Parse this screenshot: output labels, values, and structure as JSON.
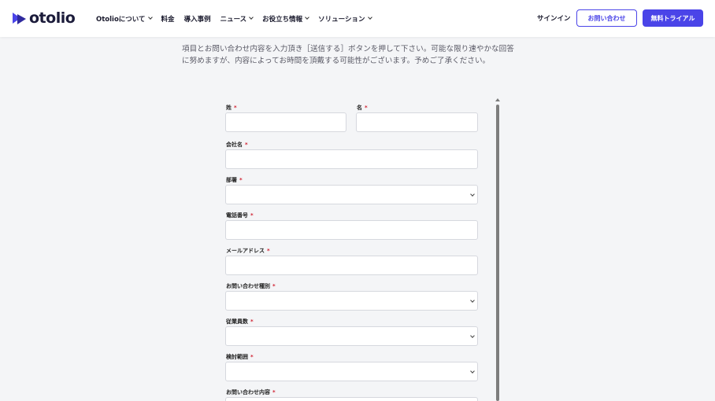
{
  "header": {
    "logo_text": "otolio",
    "nav": [
      {
        "label": "Otolioについて",
        "has_dropdown": true
      },
      {
        "label": "料金",
        "has_dropdown": false
      },
      {
        "label": "導入事例",
        "has_dropdown": false
      },
      {
        "label": "ニュース",
        "has_dropdown": true
      },
      {
        "label": "お役立ち情報",
        "has_dropdown": true
      },
      {
        "label": "ソリューション",
        "has_dropdown": true
      }
    ],
    "signin": "サインイン",
    "contact_button": "お問い合わせ",
    "trial_button": "無料トライアル",
    "accent_color": "#4a44e8"
  },
  "intro": {
    "line1": "項目とお問い合わせ内容を入力頂き［送信する］ボタンを押して下さい。可能な限り速やかな回答",
    "line2": "に努めますが、内容によってお時間を頂戴する可能性がございます。予めご了承ください。"
  },
  "form": {
    "required_mark": "*",
    "last_name": "姓",
    "first_name": "名",
    "company": "会社名",
    "department": "部署",
    "phone": "電話番号",
    "email": "メールアドレス",
    "inquiry_type": "お問い合わせ種別",
    "employees": "従業員数",
    "scope": "検討範囲",
    "inquiry_content": "お問い合わせ内容"
  }
}
